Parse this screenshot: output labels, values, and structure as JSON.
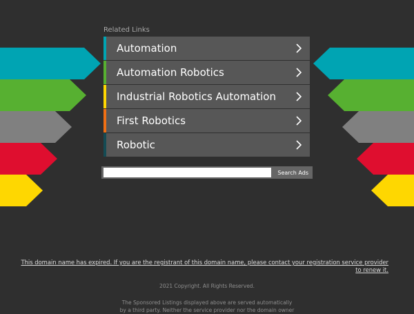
{
  "colors": {
    "background": "#2f2f2f",
    "link_background": "#575757",
    "arrow_colors": [
      "#00a4b3",
      "#57b031",
      "#808080",
      "#df0e2f",
      "#fed701"
    ],
    "link_accents": [
      "#00a4b3",
      "#57b031",
      "#fed701",
      "#ef6f14",
      "#144b54"
    ]
  },
  "related": {
    "label": "Related Links",
    "items": [
      {
        "label": "Automation",
        "icon": "chevron-right-icon"
      },
      {
        "label": "Automation Robotics",
        "icon": "chevron-right-icon"
      },
      {
        "label": "Industrial Robotics Automation",
        "icon": "chevron-right-icon"
      },
      {
        "label": "First Robotics",
        "icon": "chevron-right-icon"
      },
      {
        "label": "Robotic",
        "icon": "chevron-right-icon"
      }
    ]
  },
  "search": {
    "value": "",
    "button_label": "Search Ads"
  },
  "footer": {
    "expired_line1": "This domain name has expired. If you are the registrant of this domain name, please contact your registration service provider",
    "expired_line2": "to renew it.",
    "copyright": "2021 Copyright. All Rights Reserved.",
    "disclaimer_line1": "The Sponsored Listings displayed above are served automatically",
    "disclaimer_line2": "by a third party. Neither the service provider nor the domain owner"
  }
}
